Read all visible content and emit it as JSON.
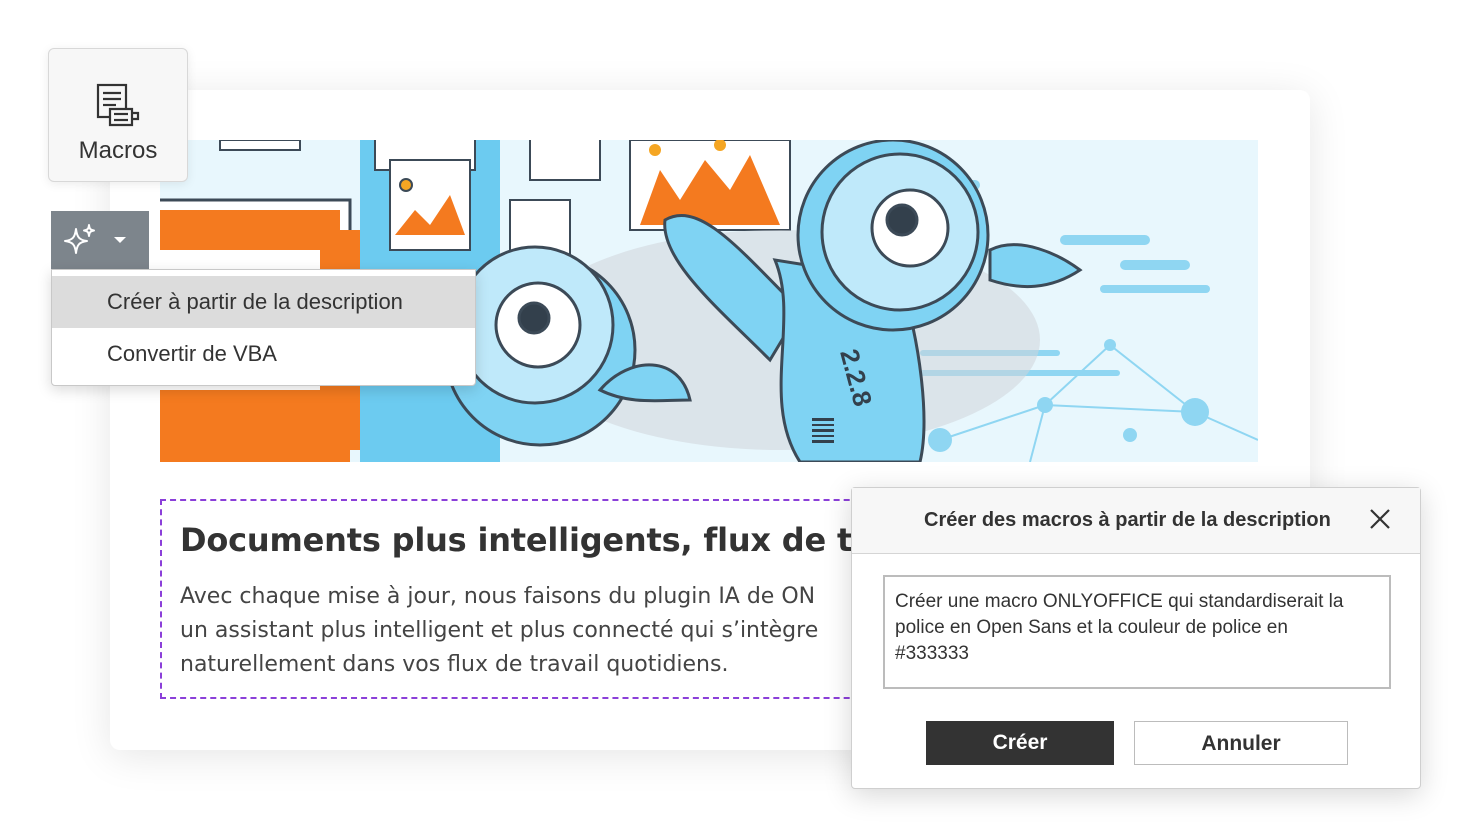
{
  "toolbar": {
    "macros_label": "Macros"
  },
  "ai_menu": {
    "items": [
      {
        "label": "Créer à partir de la description"
      },
      {
        "label": "Convertir de VBA"
      }
    ]
  },
  "document": {
    "title": "Documents plus intelligents, flux de tr",
    "body_lines": [
      "Avec chaque mise à jour, nous faisons du plugin IA de ON",
      "un assistant plus intelligent et plus connecté qui s’intègre",
      "naturellement dans vos flux de travail quotidiens."
    ],
    "hero_version": "2.2.8"
  },
  "dialog": {
    "title": "Créer des macros à partir de la description",
    "textarea_lines": [
      "Créer une macro ONLYOFFICE qui standardiserait la",
      "police en Open Sans et la couleur de police en",
      "#333333"
    ],
    "create_label": "Créer",
    "cancel_label": "Annuler"
  },
  "colors": {
    "accent_dashed": "#8b3fd9",
    "primary_button": "#333333",
    "ai_button": "#7d858c",
    "menu_active": "#dcdcdc"
  },
  "icons": [
    "macros-icon",
    "sparkle-icon",
    "chevron-down-icon",
    "close-icon"
  ]
}
